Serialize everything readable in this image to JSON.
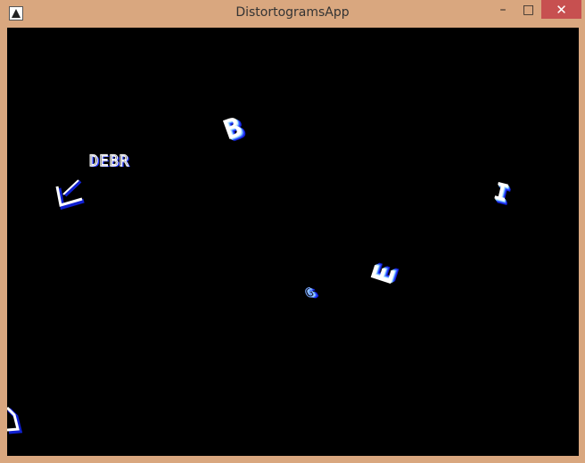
{
  "window": {
    "title": "DistortogramsApp",
    "minimize_glyph": "–",
    "maximize_glyph": "□",
    "close_glyph": "✕"
  },
  "scene": {
    "word": "DEBR",
    "floating_letters": [
      "B",
      "I",
      "E",
      "G"
    ],
    "colors": {
      "background": "#000000",
      "letter_fill": "#ffffff",
      "letter_shade": "#2a3cff",
      "frame": "#d9a77f"
    }
  }
}
